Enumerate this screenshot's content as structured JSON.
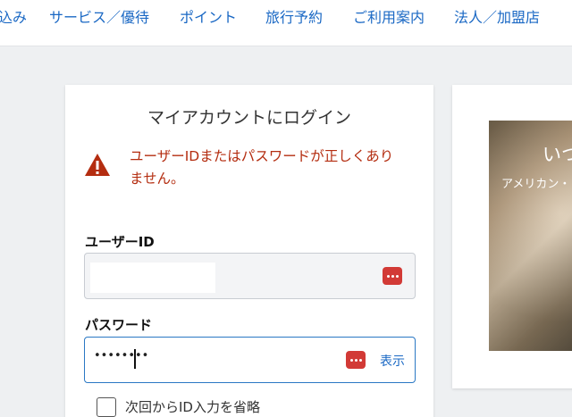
{
  "nav": {
    "items": [
      {
        "label": "込み"
      },
      {
        "label": "サービス／優待"
      },
      {
        "label": "ポイント"
      },
      {
        "label": "旅行予約"
      },
      {
        "label": "ご利用案内"
      },
      {
        "label": "法人／加盟店"
      }
    ],
    "link_color": "#1a68c4"
  },
  "login": {
    "title": "マイアカウントにログイン",
    "error_message": "ユーザーIDまたはパスワードが正しくありません。",
    "error_color": "#b42d10",
    "user_id_label": "ユーザーID",
    "user_id_value": "",
    "password_label": "パスワード",
    "password_value": "••••••••",
    "show_label": "表示",
    "remember_label": "次回からID入力を省略",
    "remember_checked": false
  },
  "promo": {
    "title": "いつ",
    "subtitle": "アメリカン・"
  },
  "icons": {
    "warning": "warning-triangle-icon",
    "password_manager": "password-manager-icon"
  }
}
